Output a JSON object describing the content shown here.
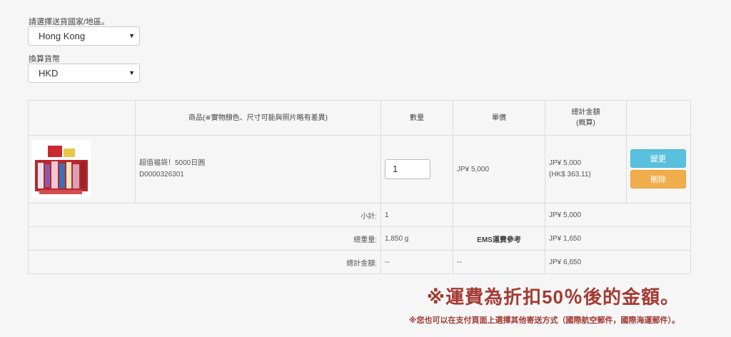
{
  "shipping": {
    "country_label": "請選擇送貨國家/地區。",
    "country_value": "Hong Kong",
    "currency_label": "換算貨幣",
    "currency_value": "HKD"
  },
  "table": {
    "headers": {
      "product": "商品(※實物顏色、尺寸可能與照片略有差異)",
      "qty": "數量",
      "unit_price": "單價",
      "total_line1": "總計金額",
      "total_line2": "(概算)"
    },
    "item": {
      "name": "超值福袋！5000日圓",
      "code": "D0000326301",
      "qty": "1",
      "unit_price": "JP¥ 5,000",
      "total_jpy": "JP¥ 5,000",
      "total_converted": "(HK$ 363.11)",
      "change_label": "變更",
      "delete_label": "刪除"
    },
    "subtotal": {
      "label": "小計:",
      "qty": "1",
      "amount": "JP¥ 5,000"
    },
    "weight": {
      "label": "總重量:",
      "value": "1,850 g",
      "shipping_label": "EMS運費參考",
      "shipping_amount": "JP¥ 1,650"
    },
    "grand": {
      "label": "總計金額:",
      "qty": "--",
      "unit": "--",
      "amount": "JP¥ 6,650"
    }
  },
  "notes": {
    "discount": "※運費為折扣50％後的金額。",
    "other_methods": "※您也可以在支付頁面上選擇其他寄送方式（國際航空郵件，國際海運郵件）。"
  },
  "colors": {
    "accent_red": "#a33a33",
    "change_btn": "#5bc0de",
    "delete_btn": "#f0ad4e"
  }
}
